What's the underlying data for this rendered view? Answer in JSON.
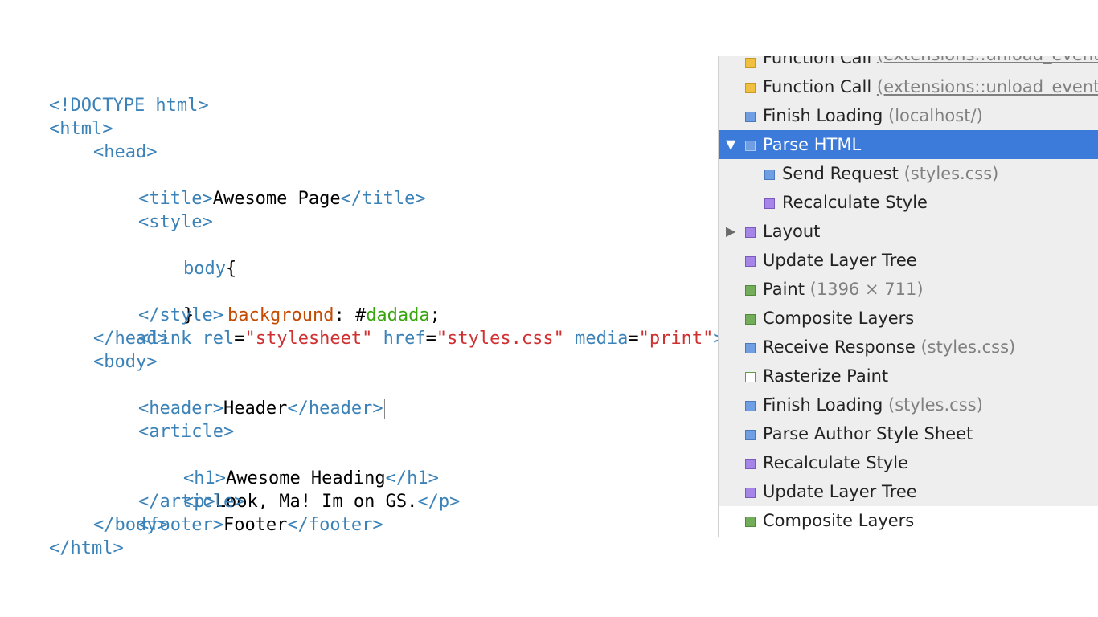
{
  "code": {
    "doctype": "<!DOCTYPE html>",
    "html_open": "<html>",
    "head_open": "<head>",
    "title_open": "<title>",
    "title_text": "Awesome Page",
    "title_close": "</title>",
    "style_open": "<style>",
    "css_selector": "body",
    "css_brace_open": "{",
    "css_property": "background",
    "css_colon": ": ",
    "css_hash": "#",
    "css_value": "dadada",
    "css_semicolon": ";",
    "css_brace_close": "}",
    "style_close": "</style>",
    "link_open": "<link",
    "link_attr_rel": "rel",
    "link_val_rel": "\"stylesheet\"",
    "link_attr_href": "href",
    "link_val_href": "\"styles.css\"",
    "link_attr_media": "media",
    "link_val_media": "\"print\"",
    "link_close": ">",
    "equals": "=",
    "head_close": "</head>",
    "body_open": "<body>",
    "header_open": "<header>",
    "header_text": "Header",
    "header_close": "</header>",
    "article_open": "<article>",
    "h1_open": "<h1>",
    "h1_text": "Awesome Heading",
    "h1_close": "</h1>",
    "p_open": "<p>",
    "p_text": "Look, Ma! Im on GS.",
    "p_close": "</p>",
    "article_close": "</article>",
    "footer_open": "<footer>",
    "footer_text": "Footer",
    "footer_close": "</footer>",
    "body_close": "</body>",
    "html_close": "</html>"
  },
  "timeline": {
    "records": [
      {
        "label": "Function Call",
        "detail": "(extensions::unload_event:",
        "color": "yellow",
        "level": 0,
        "detail_link": true
      },
      {
        "label": "Function Call",
        "detail": "(extensions::unload_event:",
        "color": "yellow",
        "level": 0,
        "detail_link": true
      },
      {
        "label": "Finish Loading",
        "detail": "(localhost/)",
        "color": "blue",
        "level": 0
      },
      {
        "label": "Parse HTML",
        "detail": "",
        "color": "blue",
        "level": 0,
        "selected": true,
        "expanded": true,
        "disclosure": "▼"
      },
      {
        "label": "Send Request",
        "detail": "(styles.css)",
        "color": "blue",
        "level": 1
      },
      {
        "label": "Recalculate Style",
        "detail": "",
        "color": "purple",
        "level": 1
      },
      {
        "label": "Layout",
        "detail": "",
        "color": "purple",
        "level": 0,
        "disclosure": "▶"
      },
      {
        "label": "Update Layer Tree",
        "detail": "",
        "color": "purple",
        "level": 0
      },
      {
        "label": "Paint",
        "detail": "(1396 × 711)",
        "color": "green",
        "level": 0
      },
      {
        "label": "Composite Layers",
        "detail": "",
        "color": "green",
        "level": 0
      },
      {
        "label": "Receive Response",
        "detail": "(styles.css)",
        "color": "blue",
        "level": 0
      },
      {
        "label": "Rasterize Paint",
        "detail": "",
        "color": "green-outline",
        "level": 0
      },
      {
        "label": "Finish Loading",
        "detail": "(styles.css)",
        "color": "blue",
        "level": 0
      },
      {
        "label": "Parse Author Style Sheet",
        "detail": "",
        "color": "blue",
        "level": 0
      },
      {
        "label": "Recalculate Style",
        "detail": "",
        "color": "purple",
        "level": 0
      },
      {
        "label": "Update Layer Tree",
        "detail": "",
        "color": "purple",
        "level": 0
      },
      {
        "label": "Composite Layers",
        "detail": "",
        "color": "green",
        "level": 0
      }
    ],
    "colors": {
      "yellow": "#f2c03f",
      "blue": "#6f9ee3",
      "purple": "#a586e8",
      "green": "#73ad5a",
      "selected_row": "#3c7bd9"
    }
  }
}
